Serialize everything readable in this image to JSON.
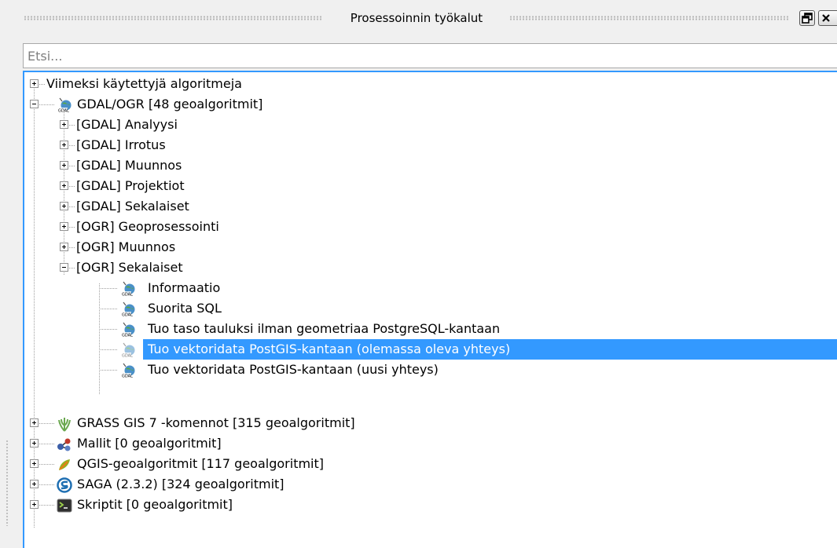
{
  "window": {
    "title": "Prosessoinnin työkalut"
  },
  "search": {
    "placeholder": "Etsi..."
  },
  "tree": {
    "recent": "Viimeksi käytettyjä algoritmeja",
    "gdal": {
      "label": "GDAL/OGR [48 geoalgoritmit]",
      "groups": [
        "[GDAL] Analyysi",
        "[GDAL] Irrotus",
        "[GDAL] Muunnos",
        "[GDAL] Projektiot",
        "[GDAL] Sekalaiset",
        "[OGR] Geoprosessointi",
        "[OGR] Muunnos"
      ],
      "ogr_misc": {
        "label": "[OGR] Sekalaiset",
        "items": [
          "Informaatio",
          "Suorita SQL",
          "Tuo taso tauluksi ilman geometriaa PostgreSQL-kantaan",
          "Tuo vektoridata PostGIS-kantaan (olemassa oleva yhteys)",
          "Tuo vektoridata PostGIS-kantaan (uusi yhteys)"
        ]
      }
    },
    "providers": [
      "GRASS GIS 7 -komennot [315 geoalgoritmit]",
      "Mallit [0 geoalgoritmit]",
      "QGIS-geoalgoritmit [117 geoalgoritmit]",
      "SAGA (2.3.2) [324 geoalgoritmit]",
      "Skriptit [0 geoalgoritmit]"
    ]
  },
  "colors": {
    "selection": "#3399ff",
    "focus_border": "#3399ff"
  }
}
